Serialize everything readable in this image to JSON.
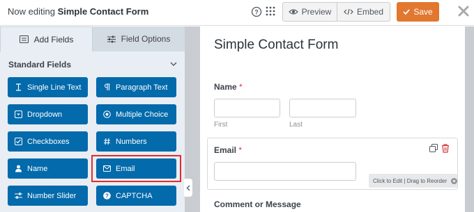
{
  "header": {
    "editing_prefix": "Now editing",
    "form_name": "Simple Contact Form",
    "preview_label": "Preview",
    "embed_label": "Embed",
    "save_label": "Save"
  },
  "sidebar": {
    "tabs": [
      {
        "label": "Add Fields",
        "icon": "list-icon",
        "active": true
      },
      {
        "label": "Field Options",
        "icon": "sliders-icon",
        "active": false
      }
    ],
    "section_title": "Standard Fields",
    "fields": [
      {
        "label": "Single Line Text",
        "icon": "text-cursor-icon"
      },
      {
        "label": "Paragraph Text",
        "icon": "paragraph-icon"
      },
      {
        "label": "Dropdown",
        "icon": "dropdown-icon"
      },
      {
        "label": "Multiple Choice",
        "icon": "radio-icon"
      },
      {
        "label": "Checkboxes",
        "icon": "checkbox-icon"
      },
      {
        "label": "Numbers",
        "icon": "hash-icon"
      },
      {
        "label": "Name",
        "icon": "user-icon"
      },
      {
        "label": "Email",
        "icon": "envelope-icon",
        "highlighted": true
      },
      {
        "label": "Number Slider",
        "icon": "slider-icon"
      },
      {
        "label": "CAPTCHA",
        "icon": "question-circle-icon"
      }
    ]
  },
  "form": {
    "title": "Simple Contact Form",
    "name_label": "Name",
    "first_sublabel": "First",
    "last_sublabel": "Last",
    "email_label": "Email",
    "required_mark": "*",
    "comment_label": "Comment or Message",
    "edit_hint": "Click to Edit | Drag to Reorder"
  },
  "colors": {
    "field_button": "#036aab",
    "save_button": "#e27730",
    "highlight": "#e32b2b"
  }
}
